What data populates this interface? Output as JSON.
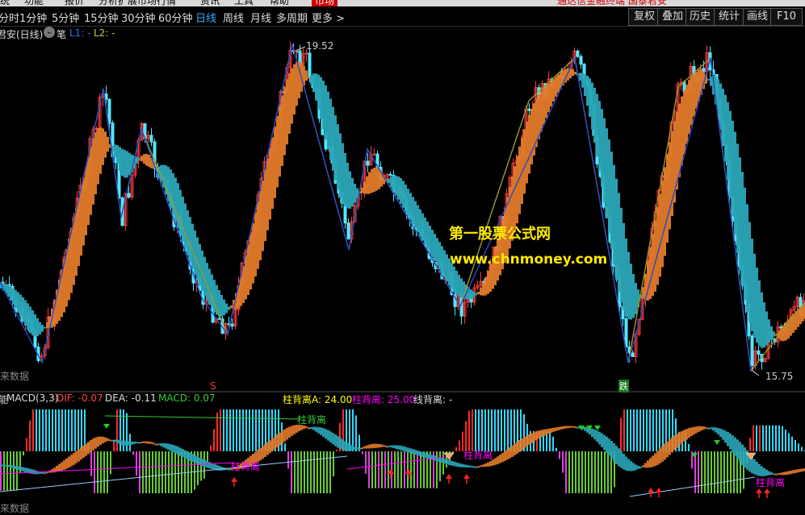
{
  "menu": {
    "items": [
      "统",
      "功能",
      "报价",
      "分析",
      "扩展市场行情",
      "资讯",
      "工具",
      "帮助"
    ],
    "market_label": "市场",
    "promo": "通达信金融终端 国泰君安"
  },
  "periods": {
    "items": [
      "分时",
      "1分钟",
      "5分钟",
      "15分钟",
      "30分钟",
      "60分钟",
      "日线",
      "周线",
      "月线",
      "多周期",
      "更多 >"
    ],
    "active": "日线"
  },
  "toolbar": {
    "buttons": [
      "复权",
      "叠加",
      "历史",
      "统计",
      "画线",
      "F10"
    ]
  },
  "main_chart": {
    "stock_label": "君安(日线)",
    "pen_label": "笔",
    "l1": "L1: -",
    "l2": "L2: -",
    "high_price": "19.52",
    "low_price": "15.75",
    "future_data_label": "来数据",
    "sell_marker": "S",
    "down_marker": "跌",
    "colors": {
      "up": "#ff3c3c",
      "down": "#52e8ff",
      "band_up": "#e27a2a",
      "band_down": "#2aa6b8",
      "pen_up": "#9a9a2c",
      "pen_down": "#2848c8"
    }
  },
  "watermark": {
    "line1": "第一股票公式网",
    "line2": "www.chnmoney.com"
  },
  "macd": {
    "title": "MACD(3,3)",
    "title_prefix": "能",
    "dif": "DIF: -0.07",
    "dea": "DEA: -0.11",
    "macd": "MACD: 0.07",
    "bar_div_a": "柱背离A: 24.00",
    "bar_div": "柱背离: 25.00",
    "line_div": "线背离: -",
    "bar_div_tag": "柱背离",
    "future_data_label": "来数据"
  }
}
